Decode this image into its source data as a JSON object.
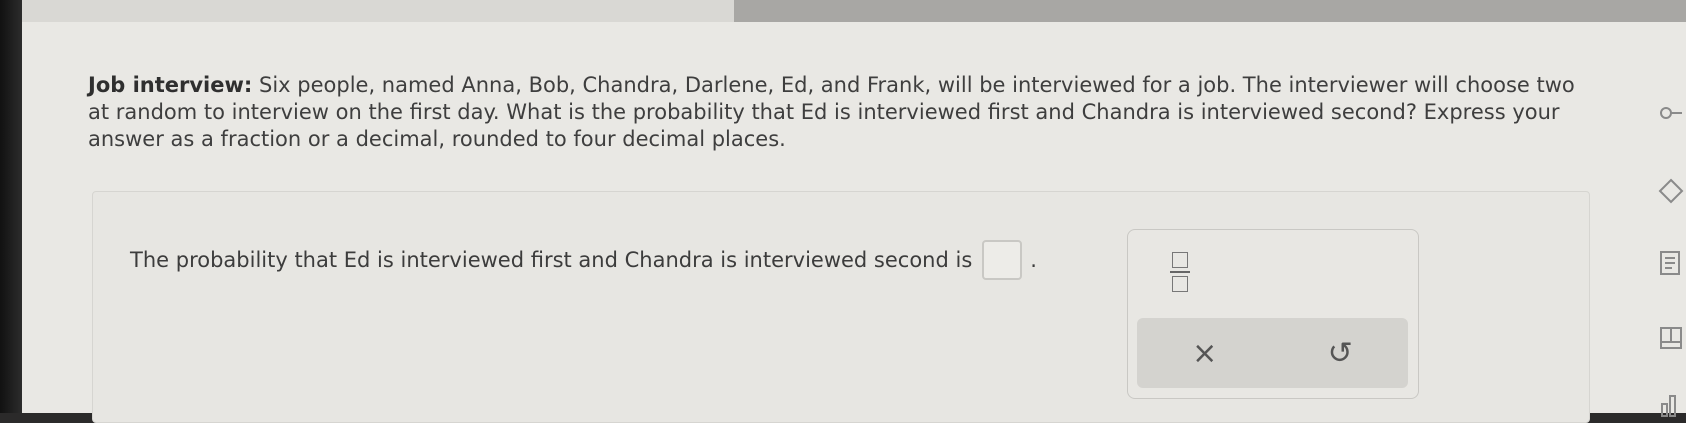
{
  "question": {
    "heading": "Job interview:",
    "text": "Six people, named Anna, Bob, Chandra, Darlene, Ed, and Frank, will be interviewed for a job. The interviewer will choose two at random to interview on the first day. What is the probability that Ed is interviewed first and Chandra is interviewed second? Express your answer as a fraction or a decimal, rounded to four decimal places."
  },
  "answer": {
    "sentence": "The probability that Ed is interviewed first and Chandra is interviewed second is",
    "value": "",
    "period": "."
  },
  "keypad": {
    "fraction_label": "fraction",
    "clear_glyph": "×",
    "undo_glyph": "↺"
  },
  "icons": [
    "fraction-icon",
    "clear-icon",
    "undo-icon",
    "key-icon",
    "eraser-icon",
    "calculator-icon",
    "book-icon",
    "chart-icon"
  ]
}
